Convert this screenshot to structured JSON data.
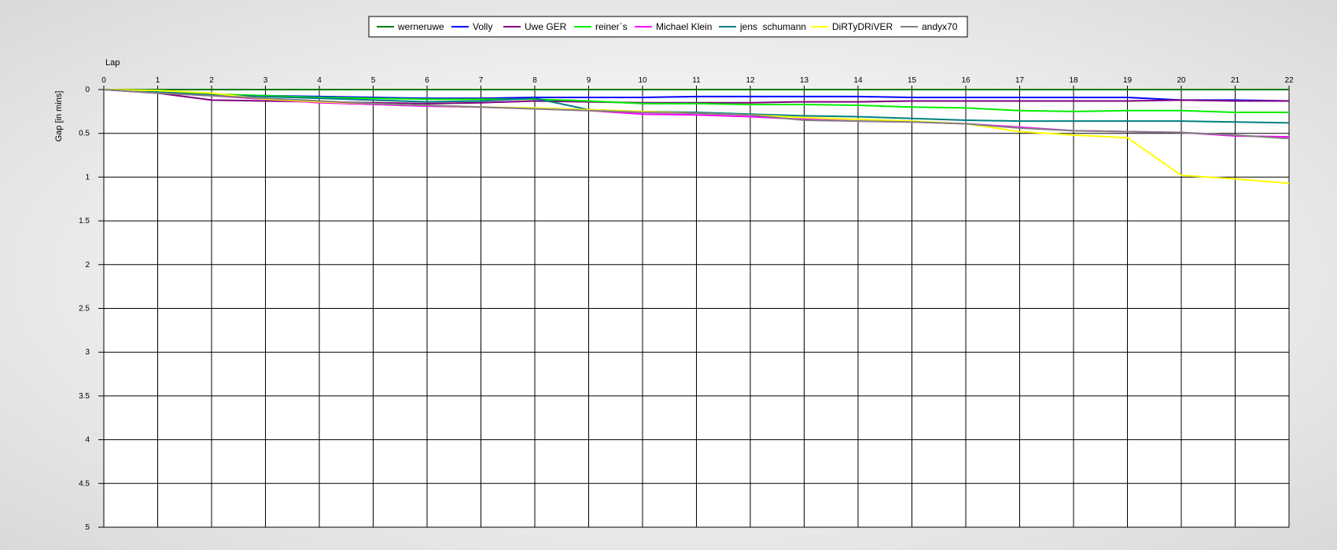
{
  "chart_data": {
    "type": "line",
    "xlabel": "Lap",
    "ylabel": "Gap [in mins]",
    "xlim": [
      0,
      22
    ],
    "ylim": [
      0,
      5
    ],
    "y_inverted": true,
    "x_axis_position": "top",
    "grid": true,
    "legend_position": "top-center",
    "x_ticks": [
      "0",
      "1",
      "2",
      "3",
      "4",
      "5",
      "6",
      "7",
      "8",
      "9",
      "10",
      "11",
      "12",
      "13",
      "14",
      "15",
      "16",
      "17",
      "18",
      "19",
      "20",
      "21",
      "22"
    ],
    "y_ticks": [
      "0",
      "0.5",
      "1",
      "1.5",
      "2",
      "2.5",
      "3",
      "3.5",
      "4",
      "4.5",
      "5"
    ],
    "x": [
      0,
      1,
      2,
      3,
      4,
      5,
      6,
      7,
      8,
      9,
      10,
      11,
      12,
      13,
      14,
      15,
      16,
      17,
      18,
      19,
      20,
      21,
      22
    ],
    "series": [
      {
        "name": "werneruwe",
        "color": "#007800",
        "values": [
          0,
          0,
          0,
          0,
          0,
          0,
          0,
          0,
          0,
          0,
          0,
          0,
          0,
          0,
          0,
          0,
          0,
          0,
          0,
          0,
          0,
          0,
          0
        ]
      },
      {
        "name": "Volly",
        "color": "#0000ff",
        "values": [
          0,
          0.03,
          0.06,
          0.07,
          0.08,
          0.09,
          0.1,
          0.1,
          0.09,
          0.09,
          0.09,
          0.08,
          0.08,
          0.08,
          0.08,
          0.09,
          0.09,
          0.09,
          0.09,
          0.09,
          0.12,
          0.12,
          0.13
        ]
      },
      {
        "name": "Uwe GER",
        "color": "#800080",
        "values": [
          0,
          0.04,
          0.12,
          0.13,
          0.14,
          0.15,
          0.16,
          0.15,
          0.13,
          0.14,
          0.15,
          0.15,
          0.15,
          0.14,
          0.14,
          0.13,
          0.13,
          0.13,
          0.13,
          0.13,
          0.12,
          0.13,
          0.13
        ]
      },
      {
        "name": "reiner`s",
        "color": "#00ee00",
        "values": [
          0,
          0.03,
          0.05,
          0.07,
          0.09,
          0.1,
          0.11,
          0.11,
          0.11,
          0.13,
          0.16,
          0.16,
          0.17,
          0.17,
          0.18,
          0.2,
          0.21,
          0.24,
          0.25,
          0.24,
          0.24,
          0.26,
          0.26
        ]
      },
      {
        "name": "Michael Klein",
        "color": "#ff00ff",
        "values": [
          0,
          0.04,
          0.07,
          0.11,
          0.15,
          0.17,
          0.19,
          0.2,
          0.22,
          0.24,
          0.28,
          0.29,
          0.31,
          0.34,
          0.36,
          0.37,
          0.39,
          0.43,
          0.47,
          0.48,
          0.49,
          0.53,
          0.54
        ]
      },
      {
        "name": "jens  schumann",
        "color": "#008080",
        "values": [
          0,
          0.03,
          0.06,
          0.08,
          0.1,
          0.12,
          0.14,
          0.13,
          0.1,
          0.23,
          0.25,
          0.26,
          0.28,
          0.3,
          0.31,
          0.33,
          0.35,
          0.36,
          0.36,
          0.36,
          0.36,
          0.37,
          0.38
        ]
      },
      {
        "name": "DiRTyDRiVER",
        "color": "#ffff00",
        "values": [
          0,
          0.01,
          0.04,
          0.11,
          0.14,
          0.16,
          0.18,
          0.2,
          0.21,
          0.23,
          0.25,
          0.27,
          0.29,
          0.32,
          0.34,
          0.36,
          0.39,
          0.48,
          0.52,
          0.55,
          0.98,
          1.02,
          1.07
        ]
      },
      {
        "name": "andyx70",
        "color": "#808080",
        "values": [
          0,
          0.04,
          0.07,
          0.1,
          0.13,
          0.16,
          0.18,
          0.2,
          0.22,
          0.24,
          0.26,
          0.27,
          0.29,
          0.35,
          0.36,
          0.37,
          0.39,
          0.44,
          0.47,
          0.48,
          0.49,
          0.52,
          0.56
        ]
      }
    ]
  }
}
